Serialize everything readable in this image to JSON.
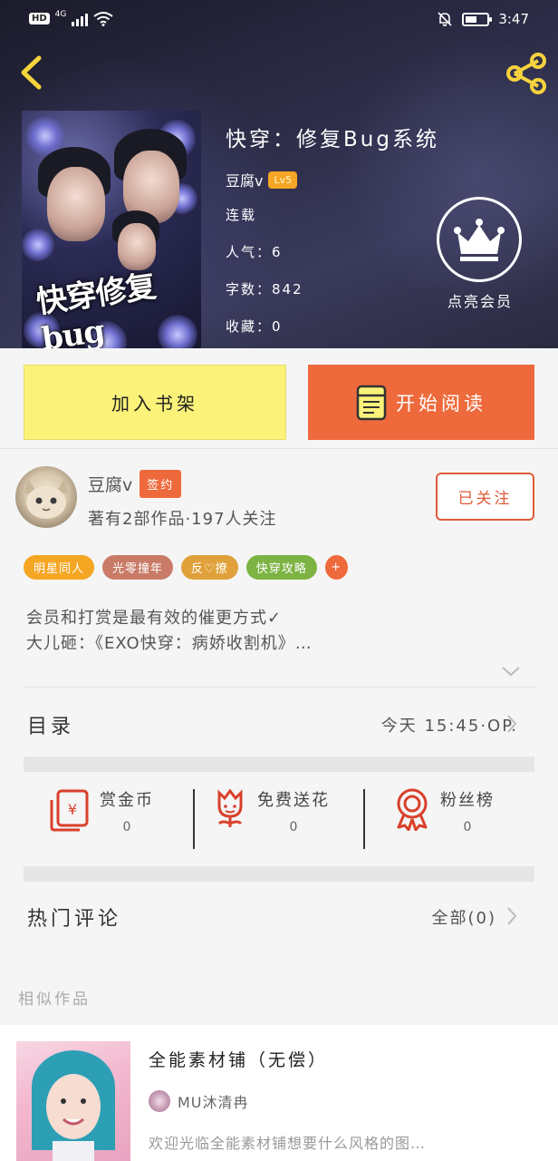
{
  "status_bar": {
    "hd": "HD",
    "network": "4G",
    "time": "3:47"
  },
  "book": {
    "title": "快穿：修复Bug系统",
    "cover_art_text": "快穿修复bug",
    "author": "豆腐v",
    "level": "Lv5",
    "status": "连载",
    "popularity": "人气：6",
    "word_count": "字数：842",
    "favorites": "收藏：0"
  },
  "vip": {
    "label": "点亮会员"
  },
  "actions": {
    "add_shelf": "加入书架",
    "start_read": "开始阅读"
  },
  "author": {
    "name": "豆腐v",
    "sign_badge": "签约",
    "stats": "著有2部作品·197人关注",
    "follow_label": "已关注"
  },
  "tags": [
    {
      "label": "明星同人",
      "color": "#f5a623"
    },
    {
      "label": "光零撞年",
      "color": "#c97b67"
    },
    {
      "label": "反♡撩",
      "color": "#e0a13a"
    },
    {
      "label": "快穿攻略",
      "color": "#7cb342"
    },
    {
      "label": "+",
      "color": "#ee6a3c"
    }
  ],
  "description": {
    "line1": "会员和打赏是最有效的催更方式✓",
    "line2": "大儿砸：《EXO快穿：病娇收割机》…"
  },
  "catalog": {
    "label": "目录",
    "update": "今天 15:45·OP."
  },
  "rewards": [
    {
      "label": "赏金币",
      "value": "0",
      "icon": "coin-envelope-icon"
    },
    {
      "label": "免费送花",
      "value": "0",
      "icon": "flower-icon"
    },
    {
      "label": "粉丝榜",
      "value": "0",
      "icon": "medal-icon"
    }
  ],
  "comments": {
    "label": "热门评论",
    "all": "全部(0)"
  },
  "similar": {
    "label": "相似作品",
    "item": {
      "title": "全能素材铺（无偿）",
      "author": "MU沐清冉",
      "desc": "欢迎光临全能素材铺想要什么风格的图…"
    }
  },
  "colors": {
    "accent_orange": "#ee6a3c",
    "yellow_button": "#fbf27a",
    "level_badge": "#f6a623"
  }
}
